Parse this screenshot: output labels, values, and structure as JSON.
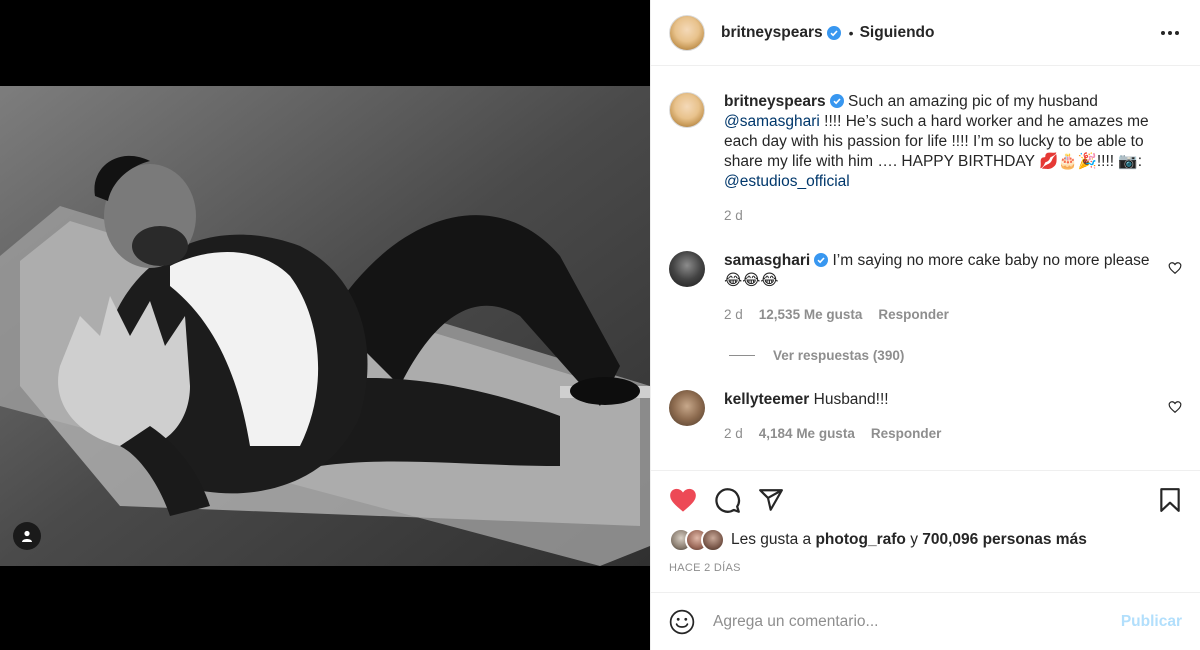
{
  "post": {
    "author": "britneyspears",
    "follow_separator": "•",
    "follow_label": "Siguiendo",
    "caption": {
      "author": "britneyspears",
      "text_1": "Such an amazing pic of my husband",
      "mention_1": "@samasghari",
      "text_2": "!!!! He’s such a hard worker and he amazes me each day with his passion for life !!!! I’m so lucky to be able to share my life with him …. HAPPY BIRTHDAY 💋🎂🎉!!!! 📷:",
      "mention_2": "@estudios_official",
      "time": "2 d"
    }
  },
  "comments": [
    {
      "author": "samasghari",
      "text": "I’m saying no more cake baby no more please 😂😂😂",
      "time": "2 d",
      "likes": "12,535 Me gusta",
      "reply": "Responder",
      "view_replies": "Ver respuestas (390)"
    },
    {
      "author": "kellyteemer",
      "text": "Husband!!!",
      "time": "2 d",
      "likes": "4,184 Me gusta",
      "reply": "Responder"
    }
  ],
  "likes_line": {
    "prefix": "Les gusta a",
    "user": "photog_rafo",
    "connector": "y",
    "others": "700,096 personas más"
  },
  "timestamp": "HACE 2 DÍAS",
  "add_comment": {
    "placeholder": "Agrega un comentario...",
    "publish": "Publicar"
  },
  "colors": {
    "like_red": "#ed4956",
    "link_blue": "#00376b",
    "verified_blue": "#3897f0",
    "publish_disabled": "#b2dffc"
  },
  "icons": {
    "verified": "verified-badge-icon",
    "more": "more-options-icon",
    "heart": "heart-icon",
    "comment": "comment-icon",
    "share": "share-icon",
    "save": "bookmark-icon",
    "emoji": "emoji-icon",
    "tag": "user-tag-icon"
  }
}
